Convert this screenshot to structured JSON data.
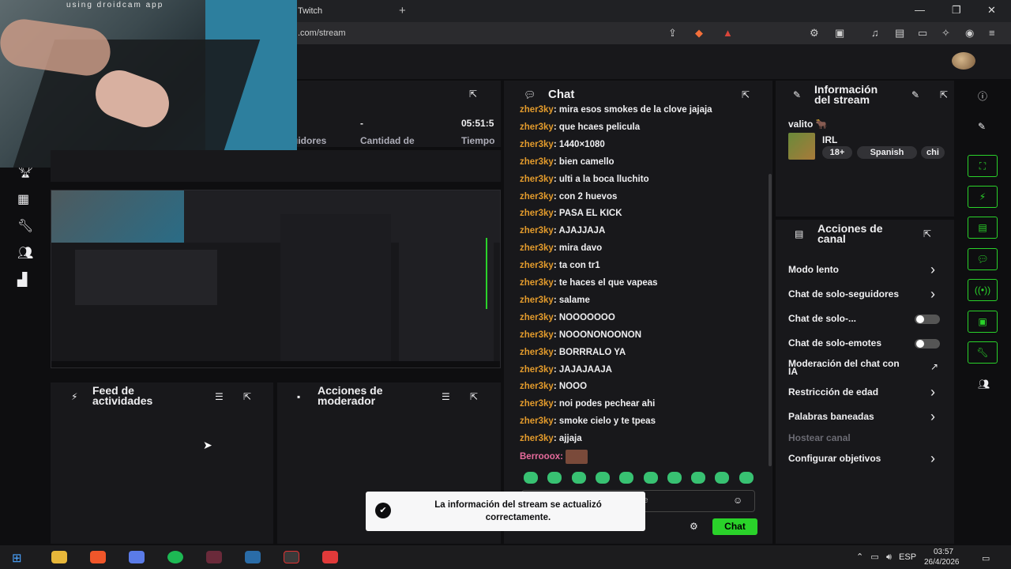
{
  "browser": {
    "tab_title": "Twitch",
    "url": ".com/stream",
    "new_tab": "+"
  },
  "webcam": {
    "caption": "using droidcam app"
  },
  "stats": {
    "followers_label": "uidores",
    "count_value": "-",
    "count_label": "Cantidad de",
    "time_value": "05:51:5",
    "time_label": "Tiempo"
  },
  "panels": {
    "activity_feed_title_1": "Feed de",
    "activity_feed_title_2": "actividades",
    "mod_actions_title_1": "Acciones de",
    "mod_actions_title_2": "moderador"
  },
  "chat": {
    "title": "Chat",
    "messages": [
      {
        "user": "zher3ky",
        "text": "mira esos smokes de la clove jajaja"
      },
      {
        "user": "zher3ky",
        "text": "que hcaes pelicula"
      },
      {
        "user": "zher3ky",
        "text": "1440×1080"
      },
      {
        "user": "zher3ky",
        "text": "bien camello"
      },
      {
        "user": "zher3ky",
        "text": "ulti a la boca lluchito"
      },
      {
        "user": "zher3ky",
        "text": "con 2 huevos"
      },
      {
        "user": "zher3ky",
        "text": "PASA EL KICK"
      },
      {
        "user": "zher3ky",
        "text": "AJAJJAJA"
      },
      {
        "user": "zher3ky",
        "text": "mira davo"
      },
      {
        "user": "zher3ky",
        "text": "ta con tr1"
      },
      {
        "user": "zher3ky",
        "text": "te haces el que vapeas"
      },
      {
        "user": "zher3ky",
        "text": "salame"
      },
      {
        "user": "zher3ky",
        "text": "NOOOOOOO"
      },
      {
        "user": "zher3ky",
        "text": "NOOONONOONON"
      },
      {
        "user": "zher3ky",
        "text": "BORRRALO YA"
      },
      {
        "user": "zher3ky",
        "text": "JAJAJAAJA"
      },
      {
        "user": "zher3ky",
        "text": "NOOO"
      },
      {
        "user": "zher3ky",
        "text": "noi podes pechear ahi"
      },
      {
        "user": "zher3ky",
        "text": "smoke cielo y te tpeas"
      },
      {
        "user": "zher3ky",
        "text": "ajjaja"
      }
    ],
    "last_user": "Berrooox:",
    "input_placeholder_fragment": "je",
    "send_label": "Chat"
  },
  "toast": {
    "text": "La información del stream se actualizó correctamente."
  },
  "info": {
    "title_1": "Información",
    "title_2": "del stream",
    "channel": "valito 🐂",
    "category": "IRL",
    "tags": [
      "18+",
      "Spanish",
      "chi"
    ]
  },
  "actions": {
    "title_1": "Acciones de",
    "title_2": "canal",
    "items": [
      {
        "label": "Modo lento",
        "control": "chevron"
      },
      {
        "label": "Chat de solo-seguidores",
        "control": "chevron"
      },
      {
        "label": "Chat de solo-...",
        "control": "toggle"
      },
      {
        "label": "Chat de solo-emotes",
        "control": "toggle"
      },
      {
        "label": "Moderación del chat con IA",
        "control": "external"
      },
      {
        "label": "Restricción de edad",
        "control": "chevron"
      },
      {
        "label": "Palabras baneadas",
        "control": "chevron"
      },
      {
        "label": "Hostear canal",
        "control": "none"
      },
      {
        "label": "Configurar objetivos",
        "control": "chevron"
      }
    ]
  },
  "taskbar": {
    "language": "ESP",
    "time": "03:57",
    "date": "26/4/2026"
  },
  "colors": {
    "accent_green": "#2ad22a",
    "username_orange": "#e39b2c",
    "username_pink": "#e66b9c",
    "panel_bg": "#18181b",
    "page_bg": "#0e0e10"
  }
}
